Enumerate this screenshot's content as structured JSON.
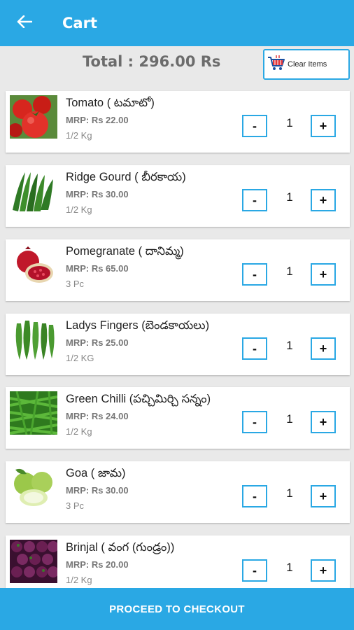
{
  "appbar": {
    "title": "Cart",
    "back_icon": "arrow-left-icon"
  },
  "summary": {
    "total_text": "Total : 296.00 Rs"
  },
  "clear": {
    "label": "Clear Items",
    "icon": "cart-icon"
  },
  "colors": {
    "primary": "#2aa8e4",
    "background": "#e9e9e9"
  },
  "items": [
    {
      "name": "Tomato ( టమాటో)",
      "mrp": "MRP: Rs 22.00",
      "unit": "1/2 Kg",
      "qty": "1",
      "minus": "-",
      "plus": "+",
      "image": "tomato-image"
    },
    {
      "name": "Ridge Gourd ( బీరకాయ)",
      "mrp": "MRP: Rs 30.00",
      "unit": "1/2 Kg",
      "qty": "1",
      "minus": "-",
      "plus": "+",
      "image": "ridge-gourd-image"
    },
    {
      "name": "Pomegranate ( దానిమ్మ)",
      "mrp": "MRP: Rs 65.00",
      "unit": "3 Pc",
      "qty": "1",
      "minus": "-",
      "plus": "+",
      "image": "pomegranate-image"
    },
    {
      "name": "Ladys Fingers (బెండకాయలు)",
      "mrp": "MRP: Rs 25.00",
      "unit": "1/2 KG",
      "qty": "1",
      "minus": "-",
      "plus": "+",
      "image": "ladys-fingers-image"
    },
    {
      "name": "Green Chilli (పచ్చిమిర్చి సన్నం)",
      "mrp": "MRP: Rs 24.00",
      "unit": "1/2 Kg",
      "qty": "1",
      "minus": "-",
      "plus": "+",
      "image": "green-chilli-image"
    },
    {
      "name": "Goa ( జామ)",
      "mrp": "MRP: Rs 30.00",
      "unit": "3 Pc",
      "qty": "1",
      "minus": "-",
      "plus": "+",
      "image": "guava-image"
    },
    {
      "name": "Brinjal ( వంగ (గుండ్రం))",
      "mrp": "MRP: Rs 20.00",
      "unit": "1/2 Kg",
      "qty": "1",
      "minus": "-",
      "plus": "+",
      "image": "brinjal-image"
    }
  ],
  "footer": {
    "checkout_label": "PROCEED TO CHECKOUT"
  }
}
